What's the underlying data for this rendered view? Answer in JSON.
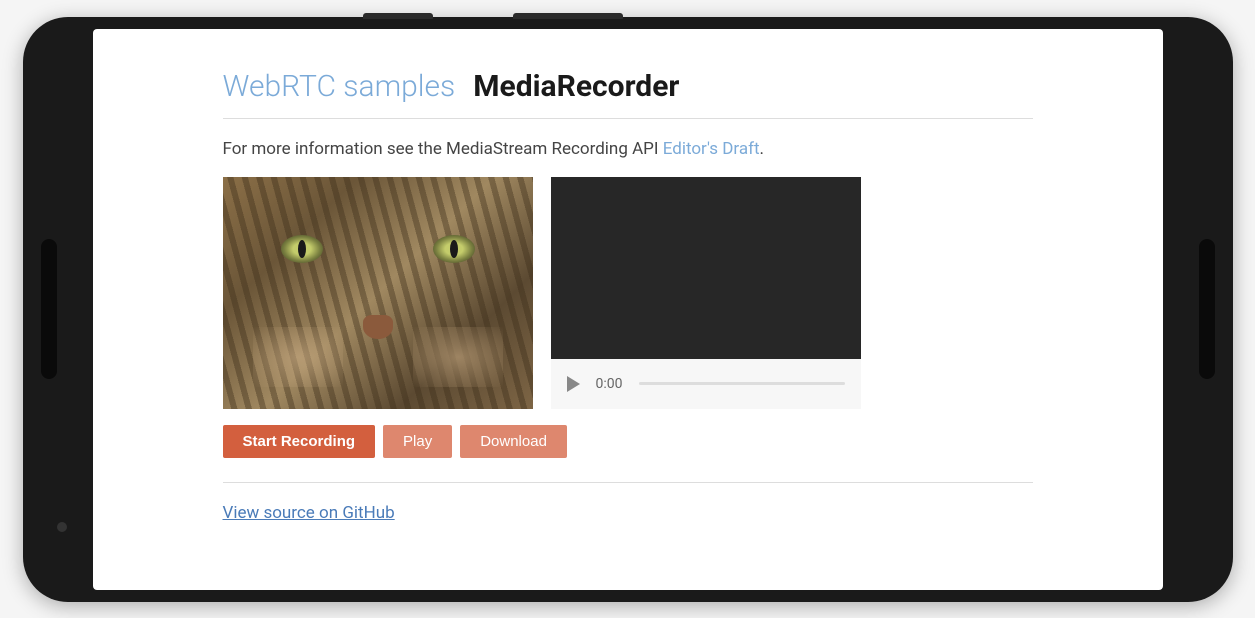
{
  "header": {
    "link_text": "WebRTC samples",
    "title": "MediaRecorder"
  },
  "description": {
    "prefix": "For more information see the MediaStream Recording API ",
    "link_text": "Editor's Draft",
    "suffix": "."
  },
  "player": {
    "time": "0:00"
  },
  "buttons": {
    "start_recording": "Start Recording",
    "play": "Play",
    "download": "Download"
  },
  "footer": {
    "source_link": "View source on GitHub"
  },
  "colors": {
    "button_bg": "#d35f3e",
    "link_color": "#7baad8",
    "source_link_color": "#4a7bb8"
  }
}
